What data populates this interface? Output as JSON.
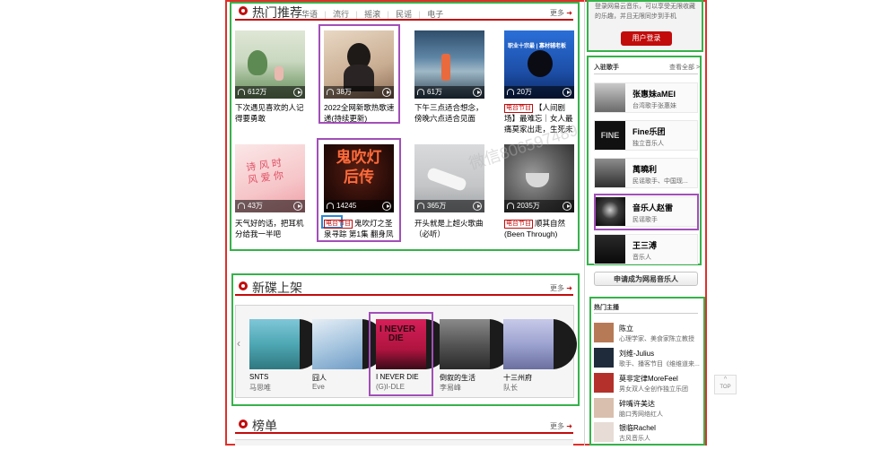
{
  "hot": {
    "title": "热门推荐",
    "tags": [
      "华语",
      "流行",
      "摇滚",
      "民谣",
      "电子"
    ],
    "more": "更多",
    "playlists": [
      {
        "count": "612万",
        "title": "下次遇见喜欢的人记得要勇敢",
        "radio": false
      },
      {
        "count": "38万",
        "title": "2022全网新歌热歌速递(持续更新)",
        "radio": false
      },
      {
        "count": "61万",
        "title": "下午三点适合想念，傍晚六点适合见面",
        "radio": false
      },
      {
        "count": "20万",
        "title": "【人间剧场】最难忘｜女人最痛莫家出走，生死未卜",
        "radio": true
      },
      {
        "count": "43万",
        "title": "天气好的话，把耳机分给我一半吧",
        "radio": false
      },
      {
        "count": "14245",
        "title": "鬼吹灯之圣泉寻踪 第1集 翻身凤凰",
        "radio": true
      },
      {
        "count": "365万",
        "title": "开头就是上超火歌曲（必听）",
        "radio": false
      },
      {
        "count": "2035万",
        "title": "顺其自然 (Been Through)",
        "radio": true
      }
    ],
    "radio_label": "电台节目"
  },
  "new_albums": {
    "title": "新碟上架",
    "more": "更多",
    "albums": [
      {
        "name": "SNTS",
        "artist": "马思唯"
      },
      {
        "name": "囧人",
        "artist": "Eve"
      },
      {
        "name": "I NEVER DIE",
        "artist": "(G)I-DLE"
      },
      {
        "name": "倒叙的生活",
        "artist": "李易峰"
      },
      {
        "name": "十三州府",
        "artist": "队长"
      }
    ]
  },
  "chart": {
    "title": "榜单",
    "more": "更多"
  },
  "login": {
    "text": "登录网易云音乐，可以享受无限收藏的乐趣，并且无限同步到手机",
    "button": "用户登录"
  },
  "singers": {
    "title": "入驻歌手",
    "view_all": "查看全部 >",
    "items": [
      {
        "name": "张惠妹aMEI",
        "desc": "台湾歌手张惠妹"
      },
      {
        "name": "Fine乐团",
        "desc": "独立音乐人"
      },
      {
        "name": "萬曉利",
        "desc": "民谣歌手、中国现..."
      },
      {
        "name": "音乐人赵雷",
        "desc": "民谣歌手"
      },
      {
        "name": "王三溥",
        "desc": "音乐人"
      }
    ],
    "apply": "申请成为网易音乐人"
  },
  "hosts": {
    "title": "热门主播",
    "items": [
      {
        "name": "陈立",
        "desc": "心理学家、美食家陈立教授"
      },
      {
        "name": "刘维-Julius",
        "desc": "歌手、播客节目《维维道来..."
      },
      {
        "name": "莫非定律MoreFeel",
        "desc": "男女双人全创作独立乐团"
      },
      {
        "name": "碎嘴许美达",
        "desc": "脑口秀网络红人"
      },
      {
        "name": "银临Rachel",
        "desc": "古风音乐人"
      }
    ]
  },
  "watermark": "微信806597489",
  "top_button": "TOP",
  "colors": {
    "accent": "#c20c0c",
    "green_box": "#36b24a",
    "purple_box": "#a24fb8",
    "red_box": "#e0302a"
  }
}
